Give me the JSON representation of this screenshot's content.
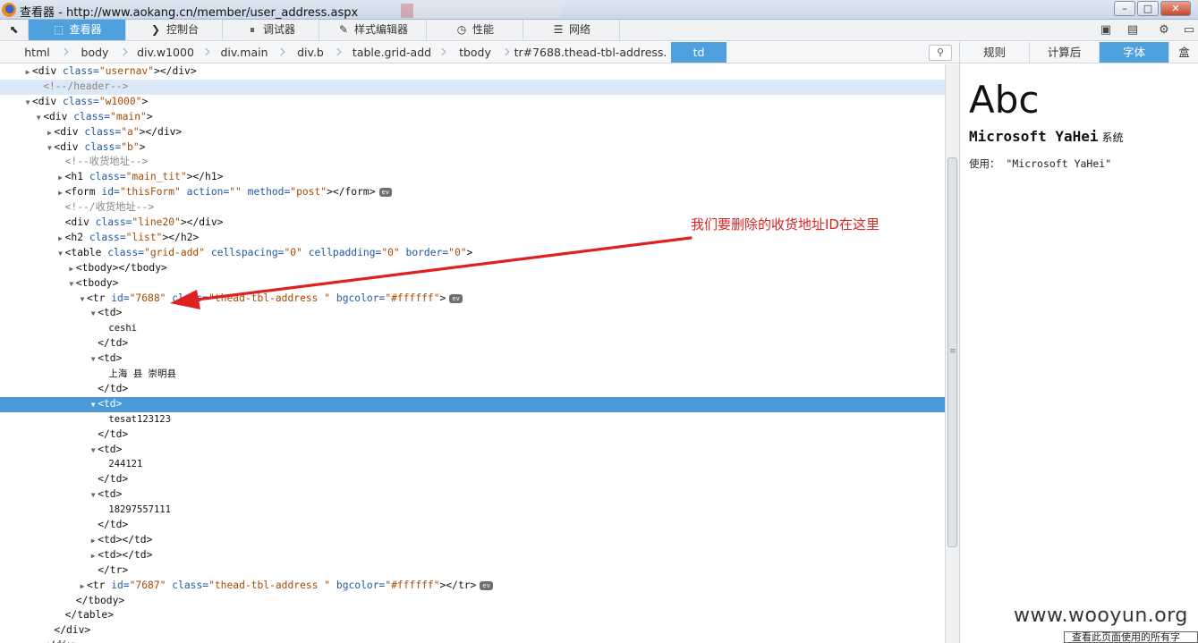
{
  "window": {
    "title": "查看器 - http://www.aokang.cn/member/user_address.aspx",
    "controls": [
      "–",
      "□",
      "✕"
    ]
  },
  "toolbar": {
    "tabs": [
      {
        "label": "查看器",
        "icon": "inspector-icon",
        "glyph": "⬚"
      },
      {
        "label": "控制台",
        "icon": "console-icon",
        "glyph": "❯"
      },
      {
        "label": "调试器",
        "icon": "debugger-icon",
        "glyph": "⏸"
      },
      {
        "label": "样式编辑器",
        "icon": "style-editor-icon",
        "glyph": "✎"
      },
      {
        "label": "性能",
        "icon": "performance-icon",
        "glyph": "◷"
      },
      {
        "label": "网络",
        "icon": "network-icon",
        "glyph": "☰"
      }
    ],
    "active_tab": 0
  },
  "breadcrumbs": {
    "items": [
      "html",
      "body",
      "div.w1000",
      "div.main",
      "div.b",
      "table.grid-add",
      "tbody",
      "tr#7688.thead-tbl-address.",
      "td"
    ],
    "active": 8
  },
  "sidebar": {
    "tabs": [
      "规则",
      "计算后",
      "字体",
      "盒"
    ],
    "active": 2,
    "preview": "Abc",
    "font_name": "Microsoft YaHei",
    "font_kind": "系统",
    "usage": "使用： \"Microsoft YaHei\""
  },
  "annotation": {
    "text": "我们要删除的收货地址ID在这里",
    "color": "#dd2222"
  },
  "watermark": "www.wooyun.org",
  "status_text": "查看此页面使用的所有字",
  "colors": {
    "accent": "#4ea1dd",
    "selected_row": "#4a9ad7"
  },
  "tree": [
    {
      "indent": 2,
      "twisty": "closed",
      "parts": [
        [
          "tag",
          "<div "
        ],
        [
          "attr",
          "class="
        ],
        [
          "val",
          "\"usernav\""
        ],
        [
          "tag",
          "></div>"
        ]
      ]
    },
    {
      "indent": 3,
      "twisty": "",
      "kind": "header",
      "parts": [
        [
          "cmt",
          "<!--/header-->"
        ]
      ]
    },
    {
      "indent": 2,
      "twisty": "open",
      "parts": [
        [
          "tag",
          "<div "
        ],
        [
          "attr",
          "class="
        ],
        [
          "val",
          "\"w1000\""
        ],
        [
          "tag",
          ">"
        ]
      ]
    },
    {
      "indent": 3,
      "twisty": "open",
      "parts": [
        [
          "tag",
          "<div "
        ],
        [
          "attr",
          "class="
        ],
        [
          "val",
          "\"main\""
        ],
        [
          "tag",
          ">"
        ]
      ]
    },
    {
      "indent": 4,
      "twisty": "closed",
      "parts": [
        [
          "tag",
          "<div "
        ],
        [
          "attr",
          "class="
        ],
        [
          "val",
          "\"a\""
        ],
        [
          "tag",
          "></div>"
        ]
      ]
    },
    {
      "indent": 4,
      "twisty": "open",
      "parts": [
        [
          "tag",
          "<div "
        ],
        [
          "attr",
          "class="
        ],
        [
          "val",
          "\"b\""
        ],
        [
          "tag",
          ">"
        ]
      ]
    },
    {
      "indent": 5,
      "twisty": "",
      "parts": [
        [
          "cmt",
          "<!--收货地址-->"
        ]
      ]
    },
    {
      "indent": 5,
      "twisty": "closed",
      "parts": [
        [
          "tag",
          "<h1 "
        ],
        [
          "attr",
          "class="
        ],
        [
          "val",
          "\"main_tit\""
        ],
        [
          "tag",
          "></h1>"
        ]
      ]
    },
    {
      "indent": 5,
      "twisty": "closed",
      "ev": "ev",
      "parts": [
        [
          "tag",
          "<form "
        ],
        [
          "attr",
          "id="
        ],
        [
          "val",
          "\"thisForm\""
        ],
        [
          "tag",
          " "
        ],
        [
          "attr",
          "action="
        ],
        [
          "val",
          "\"\""
        ],
        [
          "tag",
          " "
        ],
        [
          "attr",
          "method="
        ],
        [
          "val",
          "\"post\""
        ],
        [
          "tag",
          "></form>"
        ]
      ]
    },
    {
      "indent": 5,
      "twisty": "",
      "parts": [
        [
          "cmt",
          "<!--/收货地址-->"
        ]
      ]
    },
    {
      "indent": 5,
      "twisty": "",
      "parts": [
        [
          "tag",
          "<div "
        ],
        [
          "attr",
          "class="
        ],
        [
          "val",
          "\"line20\""
        ],
        [
          "tag",
          "></div>"
        ]
      ]
    },
    {
      "indent": 5,
      "twisty": "closed",
      "parts": [
        [
          "tag",
          "<h2 "
        ],
        [
          "attr",
          "class="
        ],
        [
          "val",
          "\"list\""
        ],
        [
          "tag",
          "></h2>"
        ]
      ]
    },
    {
      "indent": 5,
      "twisty": "open",
      "parts": [
        [
          "tag",
          "<table "
        ],
        [
          "attr",
          "class="
        ],
        [
          "val",
          "\"grid-add\""
        ],
        [
          "tag",
          " "
        ],
        [
          "attr",
          "cellspacing="
        ],
        [
          "val",
          "\"0\""
        ],
        [
          "tag",
          " "
        ],
        [
          "attr",
          "cellpadding="
        ],
        [
          "val",
          "\"0\""
        ],
        [
          "tag",
          " "
        ],
        [
          "attr",
          "border="
        ],
        [
          "val",
          "\"0\""
        ],
        [
          "tag",
          ">"
        ]
      ]
    },
    {
      "indent": 6,
      "twisty": "closed",
      "parts": [
        [
          "tag",
          "<tbody></tbody>"
        ]
      ]
    },
    {
      "indent": 6,
      "twisty": "open",
      "parts": [
        [
          "tag",
          "<tbody>"
        ]
      ]
    },
    {
      "indent": 7,
      "twisty": "open",
      "ev": "ev",
      "parts": [
        [
          "tag",
          "<tr "
        ],
        [
          "attr",
          "id="
        ],
        [
          "val",
          "\"7688\""
        ],
        [
          "tag",
          " "
        ],
        [
          "attr",
          "class="
        ],
        [
          "val",
          "\"thead-tbl-address \""
        ],
        [
          "tag",
          " "
        ],
        [
          "attr",
          "bgcolor="
        ],
        [
          "val",
          "\"#ffffff\""
        ],
        [
          "tag",
          ">"
        ]
      ]
    },
    {
      "indent": 8,
      "twisty": "open",
      "parts": [
        [
          "tag",
          "<td>"
        ]
      ]
    },
    {
      "indent": 9,
      "twisty": "",
      "parts": [
        [
          "txt",
          "ceshi"
        ]
      ]
    },
    {
      "indent": 8,
      "twisty": "",
      "parts": [
        [
          "tag",
          "</td>"
        ]
      ]
    },
    {
      "indent": 8,
      "twisty": "open",
      "parts": [
        [
          "tag",
          "<td>"
        ]
      ]
    },
    {
      "indent": 9,
      "twisty": "",
      "parts": [
        [
          "txt",
          "上海 县 崇明县"
        ]
      ]
    },
    {
      "indent": 8,
      "twisty": "",
      "parts": [
        [
          "tag",
          "</td>"
        ]
      ]
    },
    {
      "indent": 8,
      "twisty": "open",
      "kind": "selected",
      "parts": [
        [
          "tag",
          "<td>"
        ]
      ]
    },
    {
      "indent": 9,
      "twisty": "",
      "parts": [
        [
          "txt",
          "tesat123123"
        ]
      ]
    },
    {
      "indent": 8,
      "twisty": "",
      "parts": [
        [
          "tag",
          "</td>"
        ]
      ]
    },
    {
      "indent": 8,
      "twisty": "open",
      "parts": [
        [
          "tag",
          "<td>"
        ]
      ]
    },
    {
      "indent": 9,
      "twisty": "",
      "parts": [
        [
          "txt",
          "244121"
        ]
      ]
    },
    {
      "indent": 8,
      "twisty": "",
      "parts": [
        [
          "tag",
          "</td>"
        ]
      ]
    },
    {
      "indent": 8,
      "twisty": "open",
      "parts": [
        [
          "tag",
          "<td>"
        ]
      ]
    },
    {
      "indent": 9,
      "twisty": "",
      "parts": [
        [
          "txt",
          "18297557111"
        ]
      ]
    },
    {
      "indent": 8,
      "twisty": "",
      "parts": [
        [
          "tag",
          "</td>"
        ]
      ]
    },
    {
      "indent": 8,
      "twisty": "closed",
      "parts": [
        [
          "tag",
          "<td></td>"
        ]
      ]
    },
    {
      "indent": 8,
      "twisty": "closed",
      "parts": [
        [
          "tag",
          "<td></td>"
        ]
      ]
    },
    {
      "indent": 8,
      "twisty": "",
      "parts": [
        [
          "tag",
          "</tr>"
        ]
      ]
    },
    {
      "indent": 7,
      "twisty": "closed",
      "ev": "ev",
      "parts": [
        [
          "tag",
          "<tr "
        ],
        [
          "attr",
          "id="
        ],
        [
          "val",
          "\"7687\""
        ],
        [
          "tag",
          " "
        ],
        [
          "attr",
          "class="
        ],
        [
          "val",
          "\"thead-tbl-address \""
        ],
        [
          "tag",
          " "
        ],
        [
          "attr",
          "bgcolor="
        ],
        [
          "val",
          "\"#ffffff\""
        ],
        [
          "tag",
          "></tr>"
        ]
      ]
    },
    {
      "indent": 6,
      "twisty": "",
      "parts": [
        [
          "tag",
          "</tbody>"
        ]
      ]
    },
    {
      "indent": 5,
      "twisty": "",
      "parts": [
        [
          "tag",
          "</table>"
        ]
      ]
    },
    {
      "indent": 4,
      "twisty": "",
      "parts": [
        [
          "tag",
          "</div>"
        ]
      ]
    },
    {
      "indent": 3,
      "twisty": "",
      "parts": [
        [
          "tag",
          "</div>"
        ]
      ]
    }
  ]
}
